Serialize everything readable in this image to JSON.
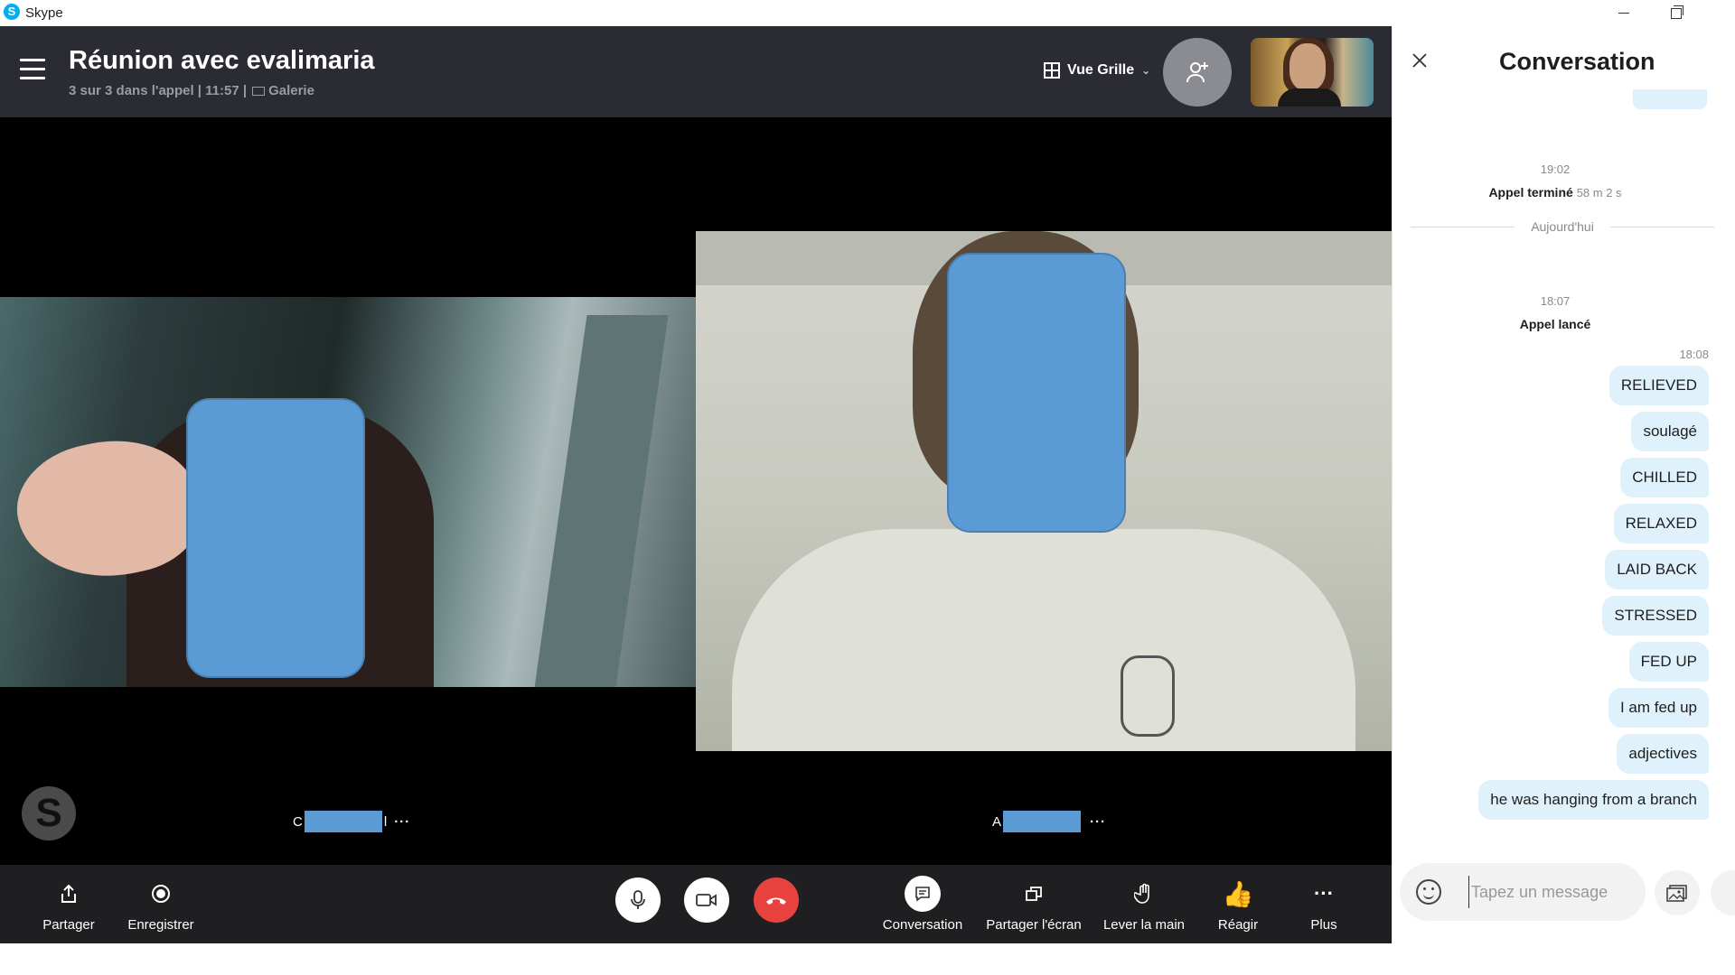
{
  "window": {
    "app_name": "Skype",
    "logo_letter": "S"
  },
  "call": {
    "title": "Réunion avec evalimaria",
    "subtitle": "3 sur 3 dans l'appel | 11:57 |",
    "gallery_label": "Galerie",
    "view_label": "Vue Grille",
    "participants": [
      {
        "initial_first": "C",
        "initial_last": "l"
      },
      {
        "initial_first": "A",
        "initial_last": ""
      }
    ],
    "badge_letter": "S"
  },
  "controls": {
    "share": "Partager",
    "record": "Enregistrer",
    "conversation": "Conversation",
    "share_screen": "Partager l'écran",
    "raise_hand": "Lever la main",
    "react": "Réagir",
    "more": "Plus",
    "react_emoji": "👍",
    "more_glyph": "···"
  },
  "chat": {
    "title": "Conversation",
    "events": [
      {
        "time": "19:02",
        "text": "Appel terminé",
        "duration": "58 m 2 s"
      },
      {
        "divider": "Aujourd'hui"
      },
      {
        "time": "18:07",
        "text": "Appel lancé"
      }
    ],
    "messages_time": "18:08",
    "messages": [
      "RELIEVED",
      "soulagé",
      "CHILLED",
      "RELAXED",
      "LAID BACK",
      "STRESSED",
      "FED UP",
      "I am fed up",
      "adjectives",
      "he was hanging from a branch"
    ],
    "input_placeholder": "Tapez un message"
  },
  "colors": {
    "header_bg": "#2b2c33",
    "controls_bg": "#1f1f22",
    "bubble_bg": "#dff2fb",
    "hangup_red": "#e8423f",
    "skype_blue": "#00aff0"
  },
  "icons": [
    "hamburger-icon",
    "grid-icon",
    "add-person-icon",
    "share-icon",
    "record-icon",
    "microphone-icon",
    "camera-icon",
    "hangup-icon",
    "chat-icon",
    "share-screen-icon",
    "raise-hand-icon",
    "thumbs-up-icon",
    "more-icon",
    "close-icon",
    "emoji-icon",
    "attach-media-icon"
  ]
}
